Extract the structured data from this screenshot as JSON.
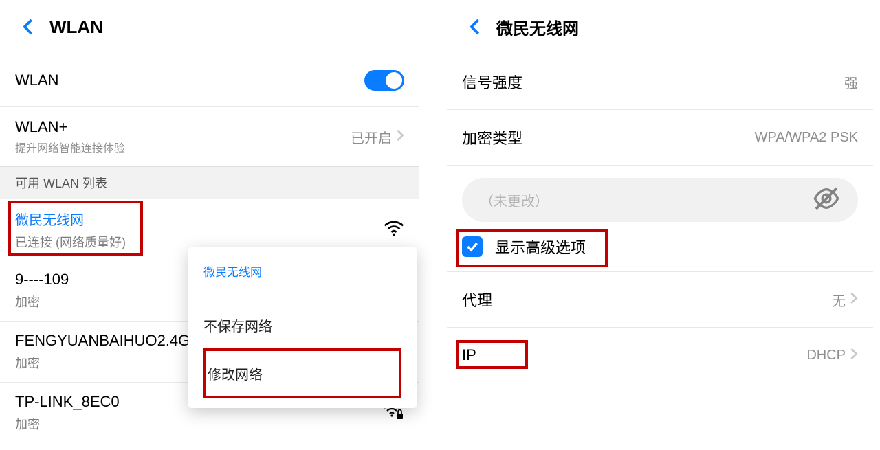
{
  "left": {
    "header": "WLAN",
    "wlan_label": "WLAN",
    "wlanplus": {
      "label": "WLAN+",
      "sub": "提升网络智能连接体验",
      "value": "已开启"
    },
    "section": "可用 WLAN 列表",
    "nets": [
      {
        "ssid": "微民无线网",
        "sub": "已连接 (网络质量好)"
      },
      {
        "ssid": "9----109",
        "sub": "加密"
      },
      {
        "ssid": "FENGYUANBAIHUO2.4G",
        "sub": "加密"
      },
      {
        "ssid": "TP-LINK_8EC0",
        "sub": "加密"
      }
    ],
    "popup": {
      "title": "微民无线网",
      "item1": "不保存网络",
      "item2": "修改网络"
    }
  },
  "right": {
    "header": "微民无线网",
    "rows": {
      "signal": {
        "label": "信号强度",
        "value": "强"
      },
      "enc": {
        "label": "加密类型",
        "value": "WPA/WPA2 PSK"
      },
      "pwd_placeholder": "（未更改）",
      "adv": "显示高级选项",
      "proxy": {
        "label": "代理",
        "value": "无"
      },
      "ip": {
        "label": "IP",
        "value": "DHCP"
      }
    }
  },
  "icons": {
    "back": "back-icon",
    "chev": "chevron-right-icon",
    "wifi": "wifi-icon",
    "eye": "eye-off-icon",
    "check": "check-icon"
  }
}
